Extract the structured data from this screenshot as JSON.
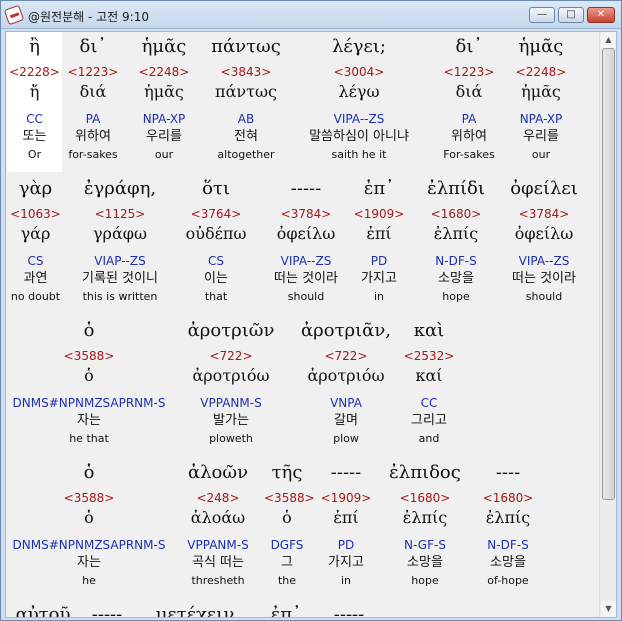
{
  "window": {
    "title": "@원전분해 - 고전 9:10",
    "minimize_glyph": "—",
    "maximize_glyph": "□",
    "close_glyph": "✕"
  },
  "scrollbar": {
    "up_glyph": "▲",
    "down_glyph": "▼"
  },
  "rows": [
    {
      "words": [
        {
          "greek": "ἢ",
          "strongs": "<2228>",
          "lemma": "ἤ",
          "morph": "CC",
          "korean": "또는",
          "english": "Or"
        },
        {
          "greek": "δι᾽",
          "strongs": "<1223>",
          "lemma": "διά",
          "morph": "PA",
          "korean": "위하여",
          "english": "for-sakes"
        },
        {
          "greek": "ἡμᾶς",
          "strongs": "<2248>",
          "lemma": "ἡμᾶς",
          "morph": "NPA-XP",
          "korean": "우리를",
          "english": "our"
        },
        {
          "greek": "πάντως",
          "strongs": "<3843>",
          "lemma": "πάντως",
          "morph": "AB",
          "korean": "전혀",
          "english": "altogether"
        },
        {
          "greek": "λέγει;",
          "strongs": "<3004>",
          "lemma": "λέγω",
          "morph": "VIPA--ZS",
          "korean": "말씀하심이 아니냐",
          "english": "saith he it"
        },
        {
          "greek": "δι᾽",
          "strongs": "<1223>",
          "lemma": "διά",
          "morph": "PA",
          "korean": "위하여",
          "english": "For-sakes"
        },
        {
          "greek": "ἡμᾶς",
          "strongs": "<2248>",
          "lemma": "ἡμᾶς",
          "morph": "NPA-XP",
          "korean": "우리를",
          "english": "our"
        }
      ]
    },
    {
      "words": [
        {
          "greek": "γὰρ",
          "strongs": "<1063>",
          "lemma": "γάρ",
          "morph": "CS",
          "korean": "과연",
          "english": "no doubt"
        },
        {
          "greek": "ἐγράφη,",
          "strongs": "<1125>",
          "lemma": "γράφω",
          "morph": "VIAP--ZS",
          "korean": "기록된 것이니",
          "english": "this is written"
        },
        {
          "greek": "ὅτι",
          "strongs": "<3764>",
          "lemma": "οὐδέπω",
          "morph": "CS",
          "korean": "이는",
          "english": "that"
        },
        {
          "greek": "-----",
          "strongs": "<3784>",
          "lemma": "ὀφείλω",
          "morph": "VIPA--ZS",
          "korean": "떠는 것이라",
          "english": "should"
        },
        {
          "greek": "ἐπ᾽",
          "strongs": "<1909>",
          "lemma": "ἐπί",
          "morph": "PD",
          "korean": "가지고",
          "english": "in"
        },
        {
          "greek": "ἐλπίδι",
          "strongs": "<1680>",
          "lemma": "ἐλπίς",
          "morph": "N-DF-S",
          "korean": "소망을",
          "english": "hope"
        },
        {
          "greek": "ὀφείλει",
          "strongs": "<3784>",
          "lemma": "ὀφείλω",
          "morph": "VIPA--ZS",
          "korean": "떠는 것이라",
          "english": "should"
        }
      ]
    },
    {
      "words": [
        {
          "greek": "ὁ",
          "strongs": "<3588>",
          "lemma": "ὁ",
          "morph": "DNMS#NPNMZSAPRNM-S",
          "korean": "자는",
          "english": "he that"
        },
        {
          "greek": "ἀροτριῶν",
          "strongs": "<722>",
          "lemma": "ἀροτριόω",
          "morph": "VPPANM-S",
          "korean": "발가는",
          "english": "ploweth"
        },
        {
          "greek": "ἀροτριᾶν,",
          "strongs": "<722>",
          "lemma": "ἀροτριόω",
          "morph": "VNPA",
          "korean": "갈며",
          "english": "plow"
        },
        {
          "greek": "καὶ",
          "strongs": "<2532>",
          "lemma": "καί",
          "morph": "CC",
          "korean": "그리고",
          "english": "and"
        }
      ]
    },
    {
      "words": [
        {
          "greek": "ὁ",
          "strongs": "<3588>",
          "lemma": "ὁ",
          "morph": "DNMS#NPNMZSAPRNM-S",
          "korean": "자는",
          "english": "he"
        },
        {
          "greek": "ἀλοῶν",
          "strongs": "<248>",
          "lemma": "ἀλοάω",
          "morph": "VPPANM-S",
          "korean": "곡식 떠는",
          "english": "thresheth"
        },
        {
          "greek": "τῆς",
          "strongs": "<3588>",
          "lemma": "ὁ",
          "morph": "DGFS",
          "korean": "그",
          "english": "the"
        },
        {
          "greek": "-----",
          "strongs": "<1909>",
          "lemma": "ἐπί",
          "morph": "PD",
          "korean": "가지고",
          "english": "in"
        },
        {
          "greek": "ἐλπιδος",
          "strongs": "<1680>",
          "lemma": "ἐλπίς",
          "morph": "N-GF-S",
          "korean": "소망을",
          "english": "hope"
        },
        {
          "greek": "----",
          "strongs": "<1680>",
          "lemma": "ἐλπίς",
          "morph": "N-DF-S",
          "korean": "소망을",
          "english": "of-hope"
        }
      ]
    },
    {
      "words": [
        {
          "greek": "αὐτοῦ"
        },
        {
          "greek": "-----"
        },
        {
          "greek": "μετέχειν"
        },
        {
          "greek": "ἐπ᾽"
        },
        {
          "greek": "-----"
        }
      ]
    }
  ]
}
